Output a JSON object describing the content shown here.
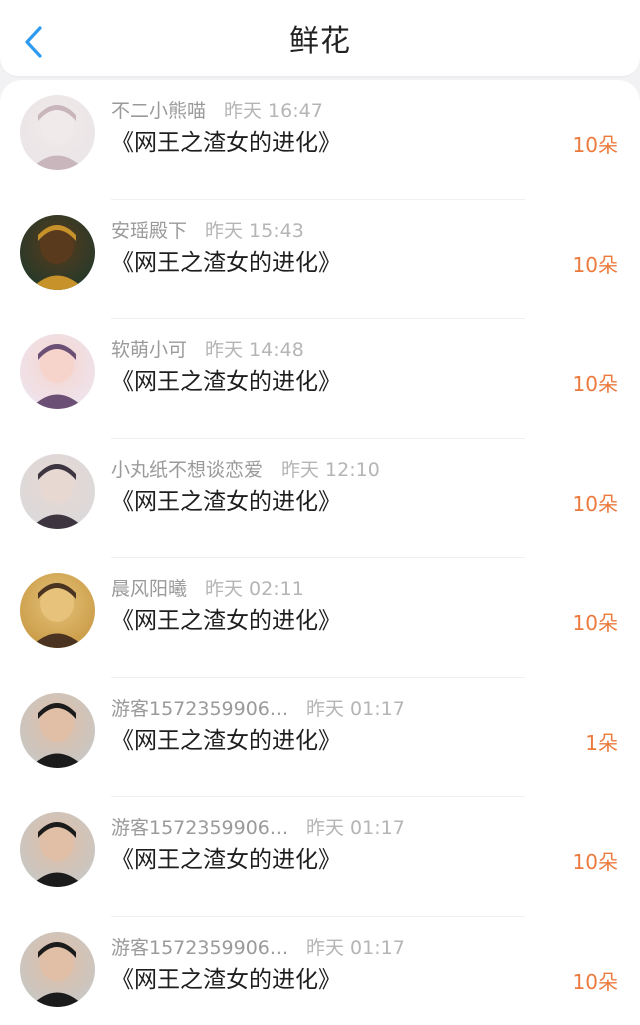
{
  "header": {
    "title": "鲜花",
    "back_icon": "chevron-left-icon",
    "accent_color": "#2f9bf0"
  },
  "rows": [
    {
      "user": "不二小熊喵",
      "time": "昨天 16:47",
      "book": "《网王之渣女的进化》",
      "count": "10朵",
      "avatar_palette": [
        "#e9e4e6",
        "#c9b6bd",
        "#f1eaea"
      ]
    },
    {
      "user": "安瑶殿下",
      "time": "昨天 15:43",
      "book": "《网王之渣女的进化》",
      "count": "10朵",
      "avatar_palette": [
        "#1d3a2c",
        "#c8922a",
        "#5a3a1c"
      ]
    },
    {
      "user": "软萌小可",
      "time": "昨天 14:48",
      "book": "《网王之渣女的进化》",
      "count": "10朵",
      "avatar_palette": [
        "#ede6f2",
        "#6b4f75",
        "#f6d4cc"
      ]
    },
    {
      "user": "小丸纸不想谈恋爱",
      "time": "昨天 12:10",
      "book": "《网王之渣女的进化》",
      "count": "10朵",
      "avatar_palette": [
        "#d9d9dc",
        "#3d3540",
        "#e8d8d2"
      ]
    },
    {
      "user": "晨风阳曦",
      "time": "昨天 02:11",
      "book": "《网王之渣女的进化》",
      "count": "10朵",
      "avatar_palette": [
        "#c5963f",
        "#4a3320",
        "#e6c27a"
      ]
    },
    {
      "user": "游客1572359906...",
      "time": "昨天 01:17",
      "book": "《网王之渣女的进化》",
      "count": "1朵",
      "avatar_palette": [
        "#c4c8c8",
        "#1b1b1b",
        "#e1bea6"
      ]
    },
    {
      "user": "游客1572359906...",
      "time": "昨天 01:17",
      "book": "《网王之渣女的进化》",
      "count": "10朵",
      "avatar_palette": [
        "#c4c8c8",
        "#1b1b1b",
        "#e1bea6"
      ]
    },
    {
      "user": "游客1572359906...",
      "time": "昨天 01:17",
      "book": "《网王之渣女的进化》",
      "count": "10朵",
      "avatar_palette": [
        "#c4c8c8",
        "#1b1b1b",
        "#e1bea6"
      ]
    }
  ],
  "colors": {
    "count": "#ec7a3d",
    "username": "#9a9a9a",
    "time": "#b5b5b5",
    "book": "#1e1e1e"
  }
}
